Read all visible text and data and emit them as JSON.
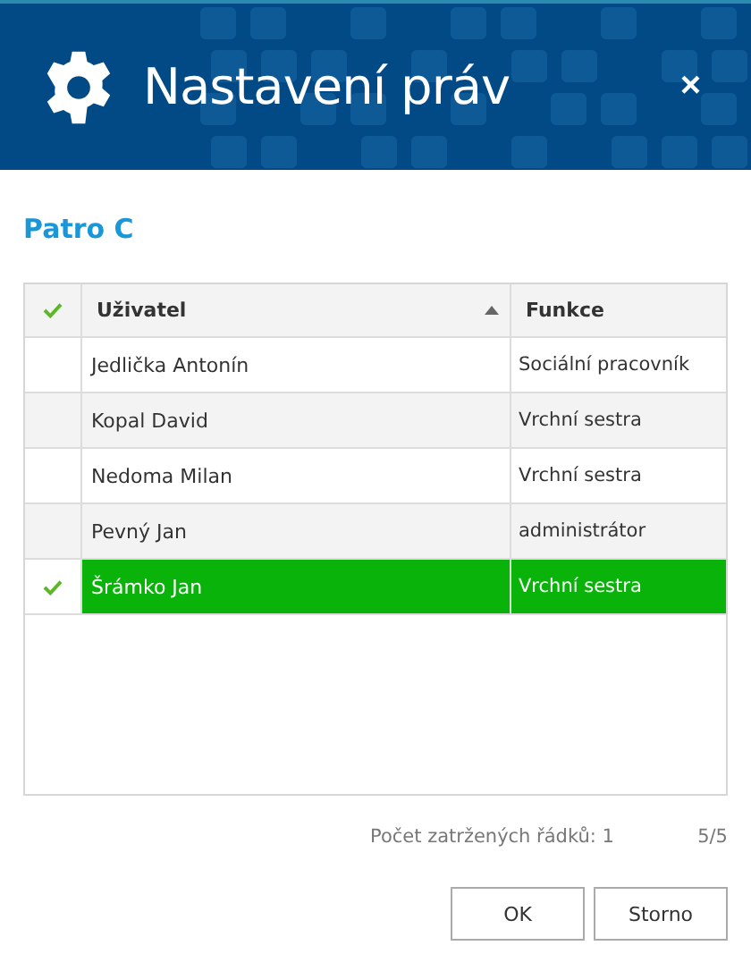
{
  "window": {
    "title": "Nastavení práv",
    "close": "×"
  },
  "section_title": "Patro C",
  "table": {
    "columns": [
      {
        "label": "Uživatel",
        "sorted": true
      },
      {
        "label": "Funkce",
        "sorted": false
      }
    ],
    "rows": [
      {
        "user": "Jedlička Antonín",
        "function": "Sociální pracovník",
        "checked": false
      },
      {
        "user": "Kopal David",
        "function": "Vrchní sestra",
        "checked": false
      },
      {
        "user": "Nedoma Milan",
        "function": "Vrchní sestra",
        "checked": false
      },
      {
        "user": "Pevný Jan",
        "function": "administrátor",
        "checked": false
      },
      {
        "user": "Šrámko Jan",
        "function": "Vrchní sestra",
        "checked": true
      }
    ]
  },
  "status": {
    "checked_count": "Počet zatržených řádků: 1",
    "pager": "5/5"
  },
  "buttons": [
    "OK",
    "Storno"
  ]
}
